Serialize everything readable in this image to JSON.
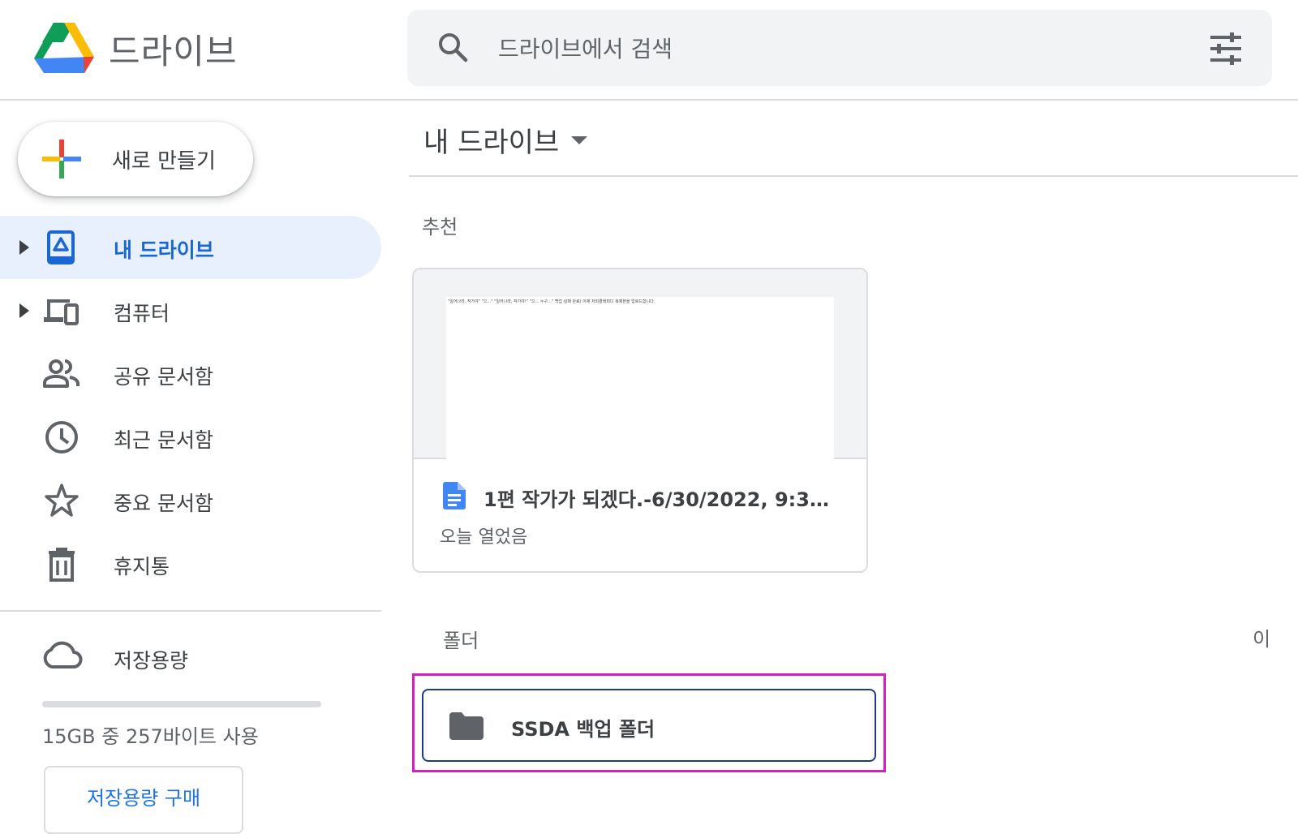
{
  "header": {
    "app_title": "드라이브",
    "search": {
      "placeholder": "드라이브에서 검색"
    }
  },
  "sidebar": {
    "new_button_label": "새로 만들기",
    "items": [
      {
        "label": "내 드라이브",
        "icon": "my-drive-icon",
        "active": true,
        "expandable": true
      },
      {
        "label": "컴퓨터",
        "icon": "computers-icon",
        "active": false,
        "expandable": true
      },
      {
        "label": "공유 문서함",
        "icon": "shared-people-icon",
        "active": false,
        "expandable": false
      },
      {
        "label": "최근 문서함",
        "icon": "clock-icon",
        "active": false,
        "expandable": false
      },
      {
        "label": "중요 문서함",
        "icon": "star-icon",
        "active": false,
        "expandable": false
      },
      {
        "label": "휴지통",
        "icon": "trash-icon",
        "active": false,
        "expandable": false
      }
    ],
    "storage": {
      "label": "저장용량",
      "usage_text": "15GB 중 257바이트 사용",
      "used_fraction": 0.0,
      "buy_label": "저장용량 구매"
    }
  },
  "main": {
    "title": "내 드라이브",
    "suggested_label": "추천",
    "suggested_file": {
      "name": "1편 작가가 되겠다.-6/30/2022, 9:36:29…",
      "meta": "오늘 열었음",
      "thumbnail_text": "\"일어나라, 작가야\" \"으...\" \"일어나라, 작가야!\" \"으... 누구...\" 백업 실패 완료) 이제 저희클래피디 복제본을 업로드합니다."
    },
    "folders_label": "폴더",
    "edge_text": "이",
    "folders": [
      {
        "name": "SSDA 백업 폴더"
      }
    ]
  },
  "colors": {
    "accent": "#1a73e8",
    "active_bg": "#e8f0fe",
    "active_text": "#1967d2",
    "highlight_box": "#d31fc4"
  }
}
